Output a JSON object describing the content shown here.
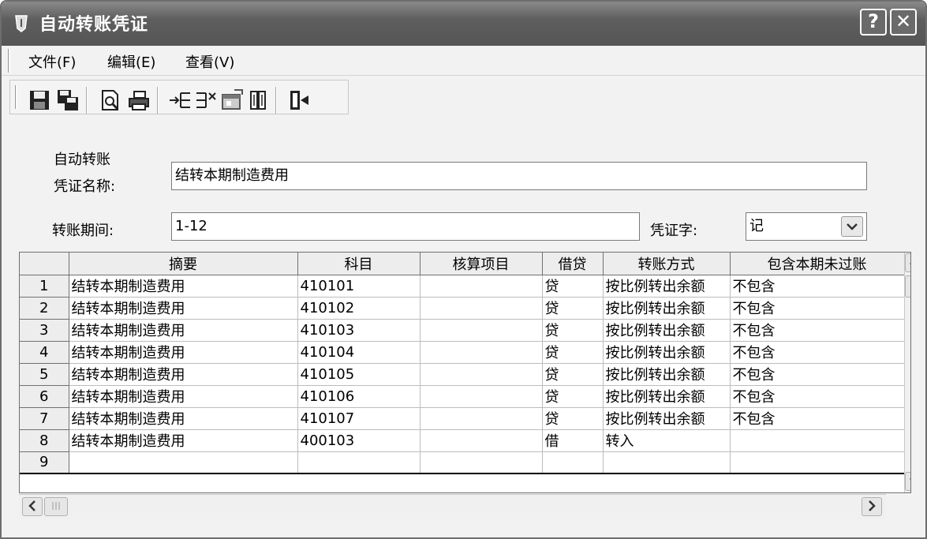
{
  "window": {
    "title": "自动转账凭证",
    "help_label": "?",
    "close_label": "✕"
  },
  "menu": {
    "items": [
      {
        "label": "文件(F)"
      },
      {
        "label": "编辑(E)"
      },
      {
        "label": "查看(V)"
      }
    ]
  },
  "toolbar": {
    "icons": [
      "save-icon",
      "save-all-icon",
      "print-preview-icon",
      "print-icon",
      "insert-row-icon",
      "delete-row-icon",
      "properties-icon",
      "columns-icon",
      "exit-icon"
    ]
  },
  "form": {
    "name_label_line1": "自动转账",
    "name_label_line2": "凭证名称:",
    "name_value": "结转本期制造费用",
    "period_label": "转账期间:",
    "period_value": "1-12",
    "voucher_word_label": "凭证字:",
    "voucher_word_value": "记"
  },
  "grid": {
    "columns": [
      "摘要",
      "科目",
      "核算项目",
      "借贷",
      "转账方式",
      "包含本期未过账"
    ],
    "rows": [
      {
        "num": "1",
        "summary": "结转本期制造费用",
        "account": "410101",
        "item": "",
        "dc": "贷",
        "method": "按比例转出余额",
        "include": "不包含"
      },
      {
        "num": "2",
        "summary": "结转本期制造费用",
        "account": "410102",
        "item": "",
        "dc": "贷",
        "method": "按比例转出余额",
        "include": "不包含"
      },
      {
        "num": "3",
        "summary": "结转本期制造费用",
        "account": "410103",
        "item": "",
        "dc": "贷",
        "method": "按比例转出余额",
        "include": "不包含"
      },
      {
        "num": "4",
        "summary": "结转本期制造费用",
        "account": "410104",
        "item": "",
        "dc": "贷",
        "method": "按比例转出余额",
        "include": "不包含"
      },
      {
        "num": "5",
        "summary": "结转本期制造费用",
        "account": "410105",
        "item": "",
        "dc": "贷",
        "method": "按比例转出余额",
        "include": "不包含"
      },
      {
        "num": "6",
        "summary": "结转本期制造费用",
        "account": "410106",
        "item": "",
        "dc": "贷",
        "method": "按比例转出余额",
        "include": "不包含"
      },
      {
        "num": "7",
        "summary": "结转本期制造费用",
        "account": "410107",
        "item": "",
        "dc": "贷",
        "method": "按比例转出余额",
        "include": "不包含"
      },
      {
        "num": "8",
        "summary": "结转本期制造费用",
        "account": "400103",
        "item": "",
        "dc": "借",
        "method": "转入",
        "include": ""
      },
      {
        "num": "9",
        "summary": "",
        "account": "",
        "item": "",
        "dc": "",
        "method": "",
        "include": ""
      }
    ]
  }
}
